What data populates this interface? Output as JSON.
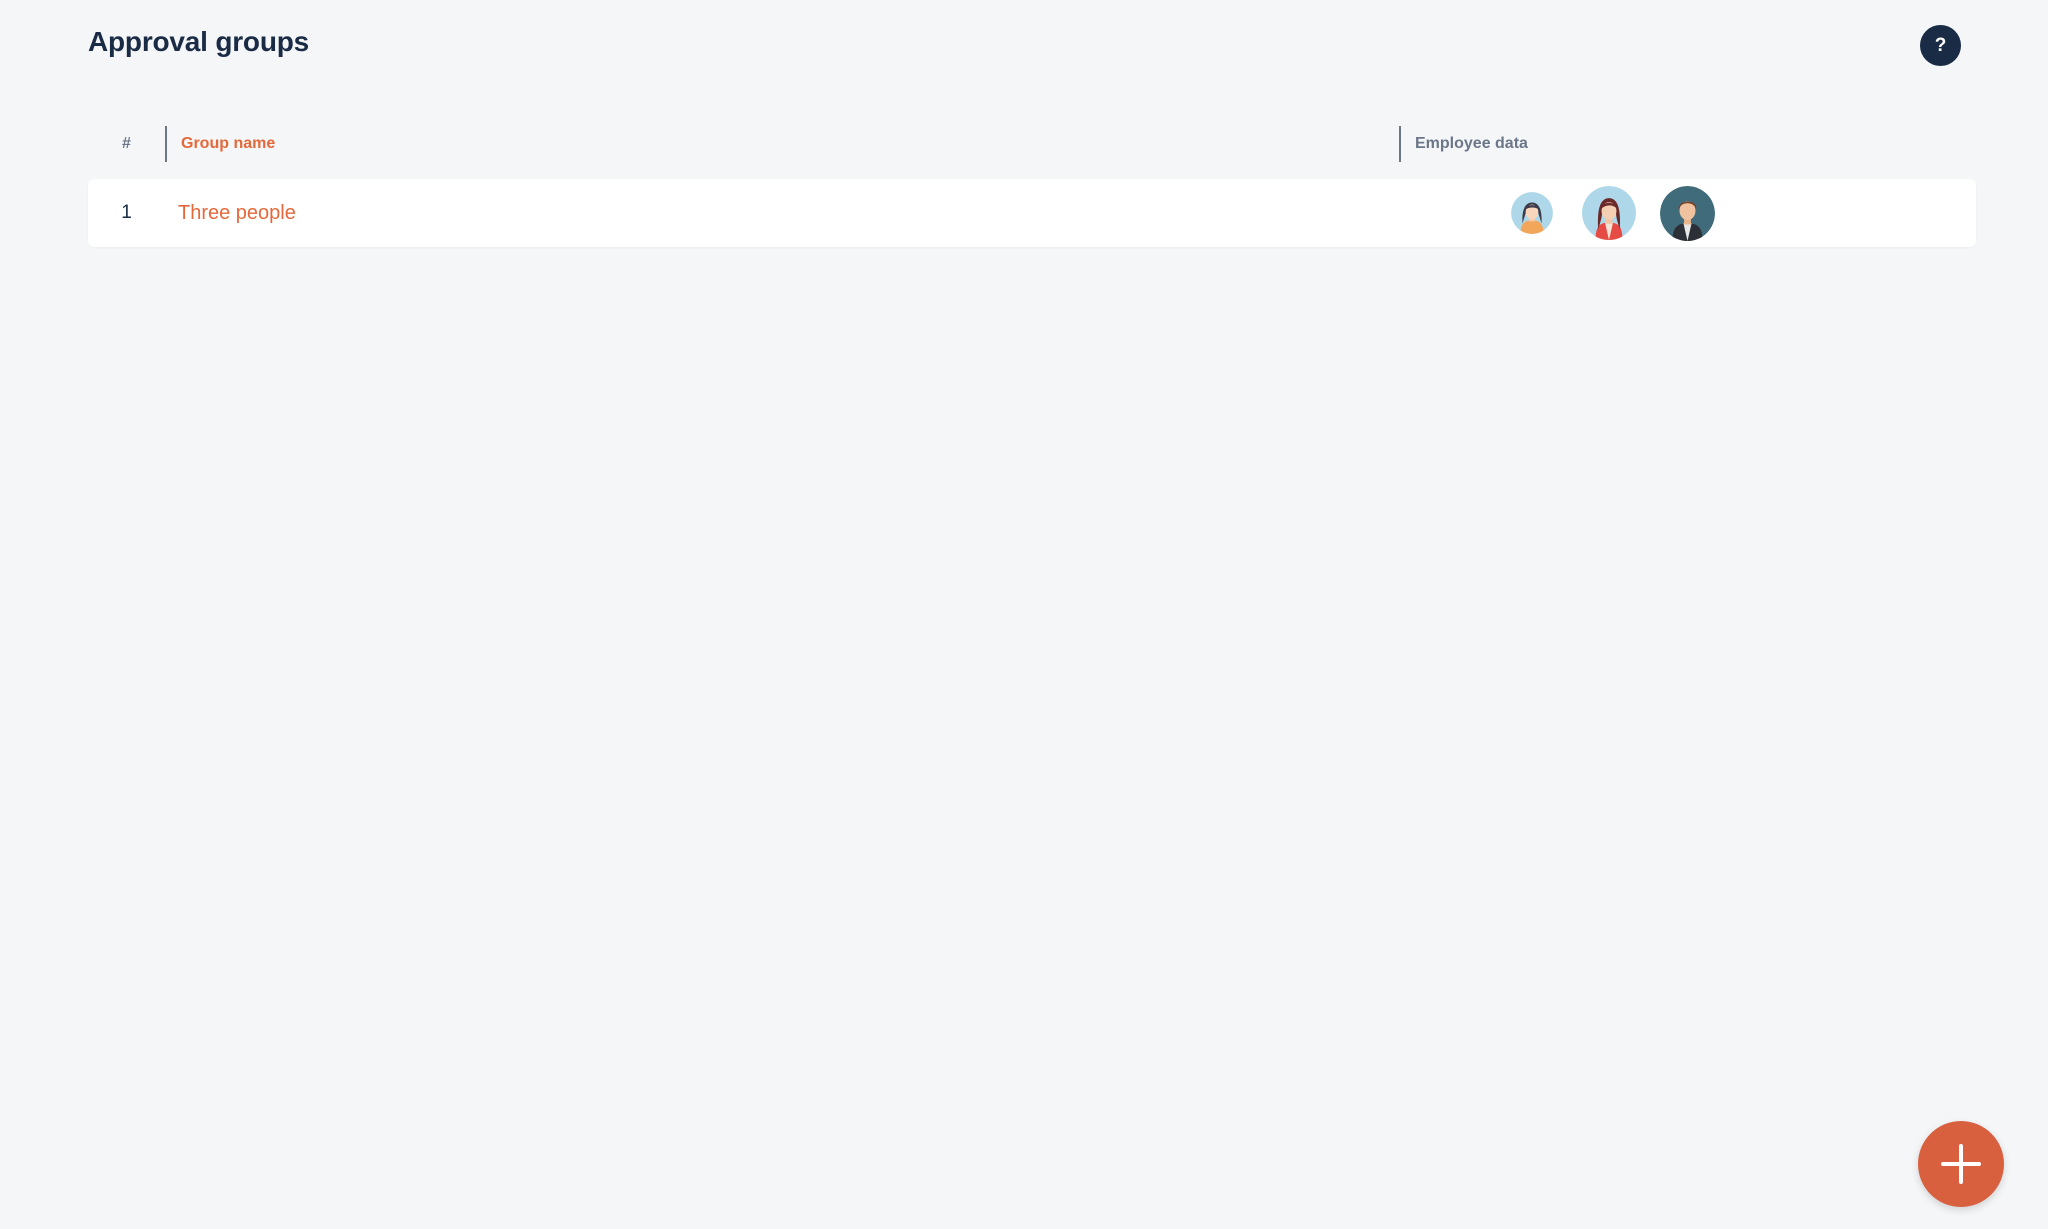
{
  "page": {
    "title": "Approval groups"
  },
  "help_button": {
    "label": "?"
  },
  "table": {
    "columns": {
      "number": "#",
      "group_name": "Group name",
      "employee_data": "Employee data"
    },
    "rows": [
      {
        "number": "1",
        "group_name": "Three people",
        "employee_count": 3
      }
    ]
  },
  "fab": {
    "icon": "plus-icon"
  },
  "colors": {
    "accent": "#e5683a",
    "fab": "#d9603f",
    "navy": "#1a2b45",
    "muted": "#6b7688",
    "background": "#f4f6f8"
  }
}
